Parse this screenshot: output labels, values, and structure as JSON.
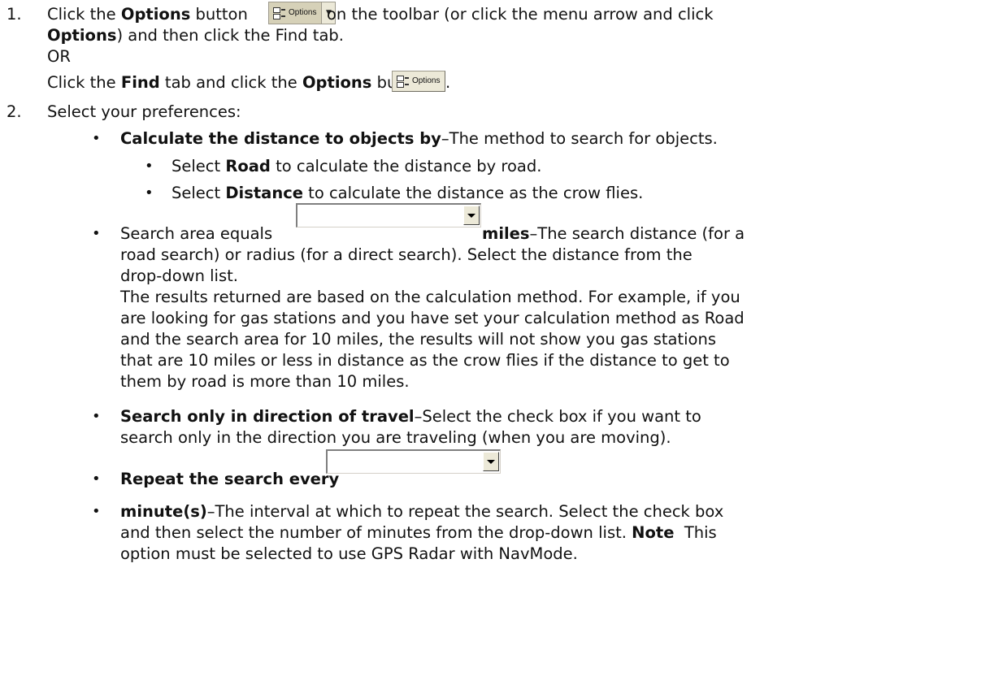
{
  "step1": {
    "number": "1.",
    "text_a": "Click the ",
    "options_bold": "Options",
    "text_b": " button ",
    "text_c": " on the toolbar (or click the menu arrow and click",
    "options_bold_2": "Options",
    "text_d": ") and then click the Find tab.",
    "or": "OR",
    "text_e": "Click the ",
    "find_bold": "Find",
    "text_f": " tab and click the ",
    "options_bold_3": "Options",
    "text_g": " button ",
    "text_h": "."
  },
  "options_button": {
    "label": "Options",
    "icon": "checklist-icon"
  },
  "step2": {
    "number": "2.",
    "text": "Select your preferences:"
  },
  "calc": {
    "bold": "Calculate the distance to objects by",
    "text": "–The method to search for objects.",
    "road_a": "Select ",
    "road_bold": "Road",
    "road_b": " to calculate the distance by road.",
    "dist_a": "Select ",
    "dist_bold": "Distance",
    "dist_b": " to calculate the distance as the crow flies."
  },
  "search_area": {
    "bold": "Search area equals",
    "combo_value": "",
    "miles_bold": "miles",
    "text_1": "–The search distance (for a",
    "text_2": "road search) or radius (for a direct search). Select the distance from the",
    "text_3": "drop-down list.",
    "text_4": "The results returned are based on the calculation method. For example, if you",
    "text_5": "are looking for gas stations and you have set your calculation method as Road",
    "text_6": "and the search area for 10 miles, the results will not show you gas stations",
    "text_7": "that are 10 miles or less in distance as the crow flies if the distance to get to",
    "text_8": "them by road is more than 10 miles."
  },
  "direction": {
    "bold": "Search only in direction of travel",
    "text_1": "–Select the check box if you want to",
    "text_2": "search only in the direction you are traveling (when you are moving)."
  },
  "repeat": {
    "bold": "Repeat the search every",
    "combo_value": ""
  },
  "minutes": {
    "bold": "minute(s)",
    "text_1": "–The interval at which to repeat the search. Select the check box",
    "text_2": "and then select the number of minutes from the drop-down list. ",
    "note_bold": "Note",
    "text_3": "  This",
    "text_4": "option must be selected to use GPS Radar with NavMode."
  },
  "bullet_char": "•"
}
